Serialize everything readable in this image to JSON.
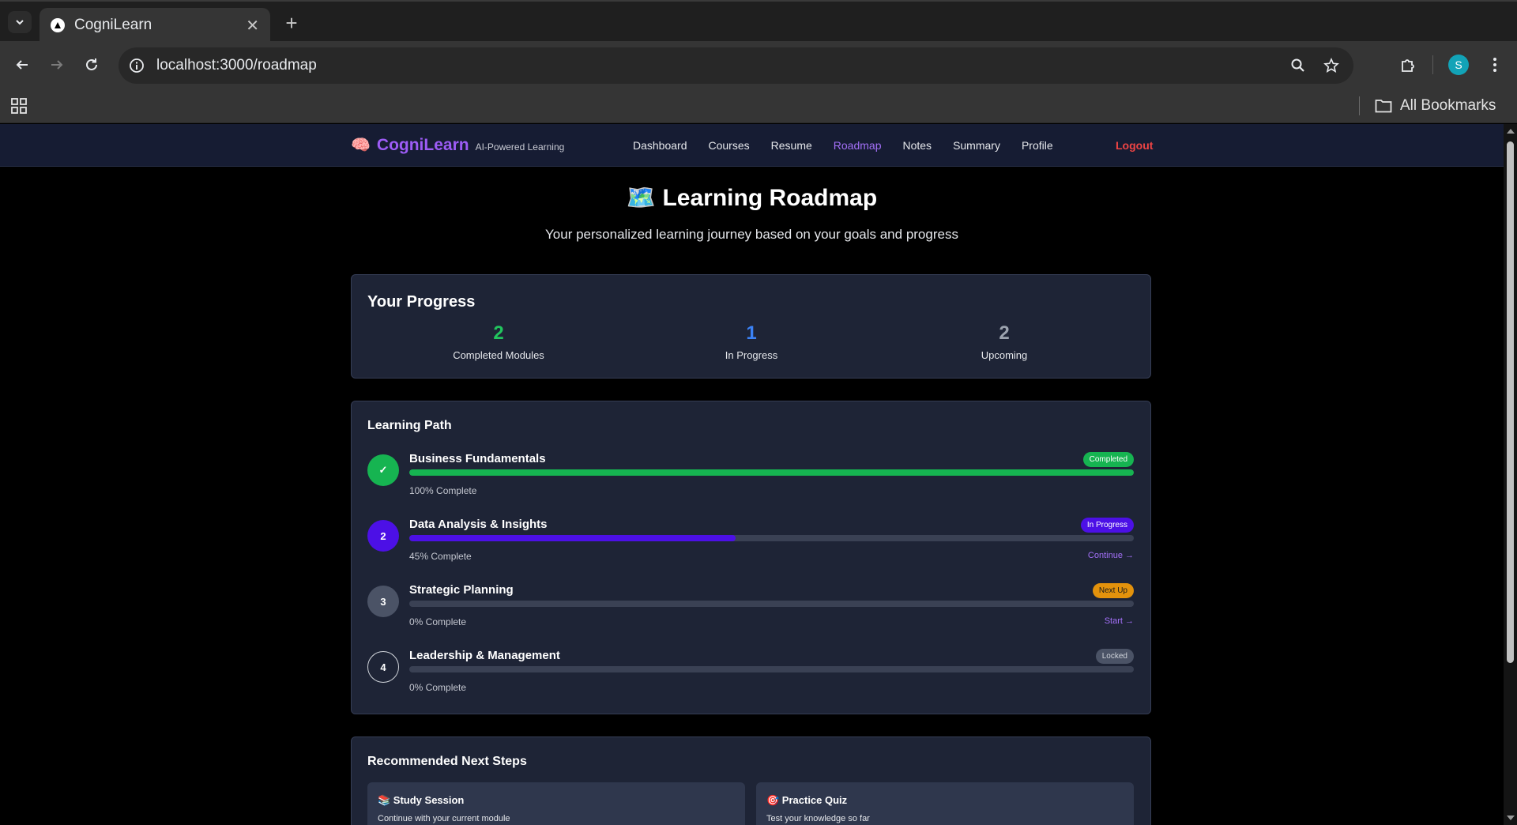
{
  "browser": {
    "tab_title": "CogniLearn",
    "url": "localhost:3000/roadmap",
    "bookmarks_label": "All Bookmarks",
    "profile_initial": "S"
  },
  "app": {
    "brand_emoji": "🧠",
    "brand_name": "CogniLearn",
    "brand_tagline": "AI-Powered Learning",
    "nav": [
      {
        "label": "Dashboard"
      },
      {
        "label": "Courses"
      },
      {
        "label": "Resume"
      },
      {
        "label": "Roadmap",
        "active": true
      },
      {
        "label": "Notes"
      },
      {
        "label": "Summary"
      },
      {
        "label": "Profile"
      }
    ],
    "logout_label": "Logout"
  },
  "hero": {
    "title": "🗺️ Learning Roadmap",
    "subtitle": "Your personalized learning journey based on your goals and progress"
  },
  "progress": {
    "title": "Your Progress",
    "stats": [
      {
        "value": "2",
        "label": "Completed Modules",
        "color": "#22c55e"
      },
      {
        "value": "1",
        "label": "In Progress",
        "color": "#3b82f6"
      },
      {
        "value": "2",
        "label": "Upcoming",
        "color": "#9ca3af"
      }
    ]
  },
  "path": {
    "title": "Learning Path",
    "modules": [
      {
        "marker": "✓",
        "title": "Business Fundamentals",
        "badge": "Completed",
        "progress": 1.0,
        "pct_label": "100% Complete",
        "action": "",
        "circle_color": "#16b451",
        "fill_color": "#16b451",
        "badge_bg": "#16b451",
        "badge_fg": "#ffffff"
      },
      {
        "marker": "2",
        "title": "Data Analysis & Insights",
        "badge": "In Progress",
        "progress": 0.45,
        "pct_label": "45% Complete",
        "action": "Continue →",
        "circle_color": "#4c10e6",
        "fill_color": "#4c10e6",
        "badge_bg": "#4c10e6",
        "badge_fg": "#ffffff"
      },
      {
        "marker": "3",
        "title": "Strategic Planning",
        "badge": "Next Up",
        "progress": 0.0,
        "pct_label": "0% Complete",
        "action": "Start →",
        "circle_color": "#4b5366",
        "fill_color": "#4b5366",
        "badge_bg": "#e3920c",
        "badge_fg": "#1a1a1a"
      },
      {
        "marker": "4",
        "title": "Leadership & Management",
        "badge": "Locked",
        "progress": 0.0,
        "pct_label": "0% Complete",
        "action": "",
        "circle_color": "#1e2436",
        "fill_color": "#4b5366",
        "badge_bg": "#4b5366",
        "badge_fg": "#d1d5db"
      }
    ]
  },
  "recommended": {
    "title": "Recommended Next Steps",
    "items": [
      {
        "title": "📚 Study Session",
        "desc": "Continue with your current module"
      },
      {
        "title": "🎯 Practice Quiz",
        "desc": "Test your knowledge so far"
      }
    ]
  }
}
